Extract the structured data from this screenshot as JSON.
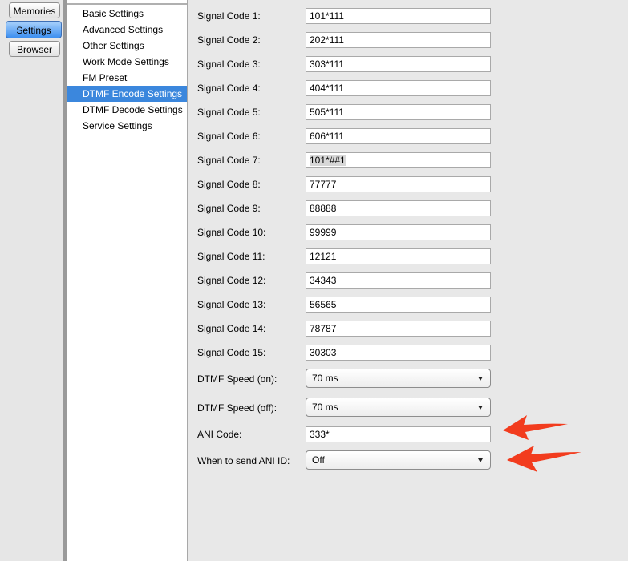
{
  "tabs": [
    {
      "label": "Memories",
      "active": false
    },
    {
      "label": "Settings",
      "active": true
    },
    {
      "label": "Browser",
      "active": false
    }
  ],
  "nav": {
    "items": [
      {
        "label": "Basic Settings",
        "selected": false
      },
      {
        "label": "Advanced Settings",
        "selected": false
      },
      {
        "label": "Other Settings",
        "selected": false
      },
      {
        "label": "Work Mode Settings",
        "selected": false
      },
      {
        "label": "FM Preset",
        "selected": false
      },
      {
        "label": "DTMF Encode Settings",
        "selected": true
      },
      {
        "label": "DTMF Decode Settings",
        "selected": false
      },
      {
        "label": "Service Settings",
        "selected": false
      }
    ]
  },
  "signal_codes": [
    {
      "label": "Signal Code 1:",
      "value": "101*111"
    },
    {
      "label": "Signal Code 2:",
      "value": "202*111"
    },
    {
      "label": "Signal Code 3:",
      "value": "303*111"
    },
    {
      "label": "Signal Code 4:",
      "value": "404*111"
    },
    {
      "label": "Signal Code 5:",
      "value": "505*111"
    },
    {
      "label": "Signal Code 6:",
      "value": "606*111"
    },
    {
      "label": "Signal Code 7:",
      "value": "101*##1",
      "highlighted": true
    },
    {
      "label": "Signal Code 8:",
      "value": "77777"
    },
    {
      "label": "Signal Code 9:",
      "value": "88888"
    },
    {
      "label": "Signal Code 10:",
      "value": "99999"
    },
    {
      "label": "Signal Code 11:",
      "value": "12121"
    },
    {
      "label": "Signal Code 12:",
      "value": "34343"
    },
    {
      "label": "Signal Code 13:",
      "value": "56565"
    },
    {
      "label": "Signal Code 14:",
      "value": "78787"
    },
    {
      "label": "Signal Code 15:",
      "value": "30303"
    }
  ],
  "dtmf_speed_on": {
    "label": "DTMF Speed (on):",
    "value": "70 ms"
  },
  "dtmf_speed_off": {
    "label": "DTMF Speed (off):",
    "value": "70 ms"
  },
  "ani_code": {
    "label": "ANI Code:",
    "value": "333*"
  },
  "ani_send": {
    "label": "When to send ANI ID:",
    "value": "Off"
  },
  "colors": {
    "accent": "#3b87dd",
    "annotation_arrow": "#f23c1e"
  }
}
